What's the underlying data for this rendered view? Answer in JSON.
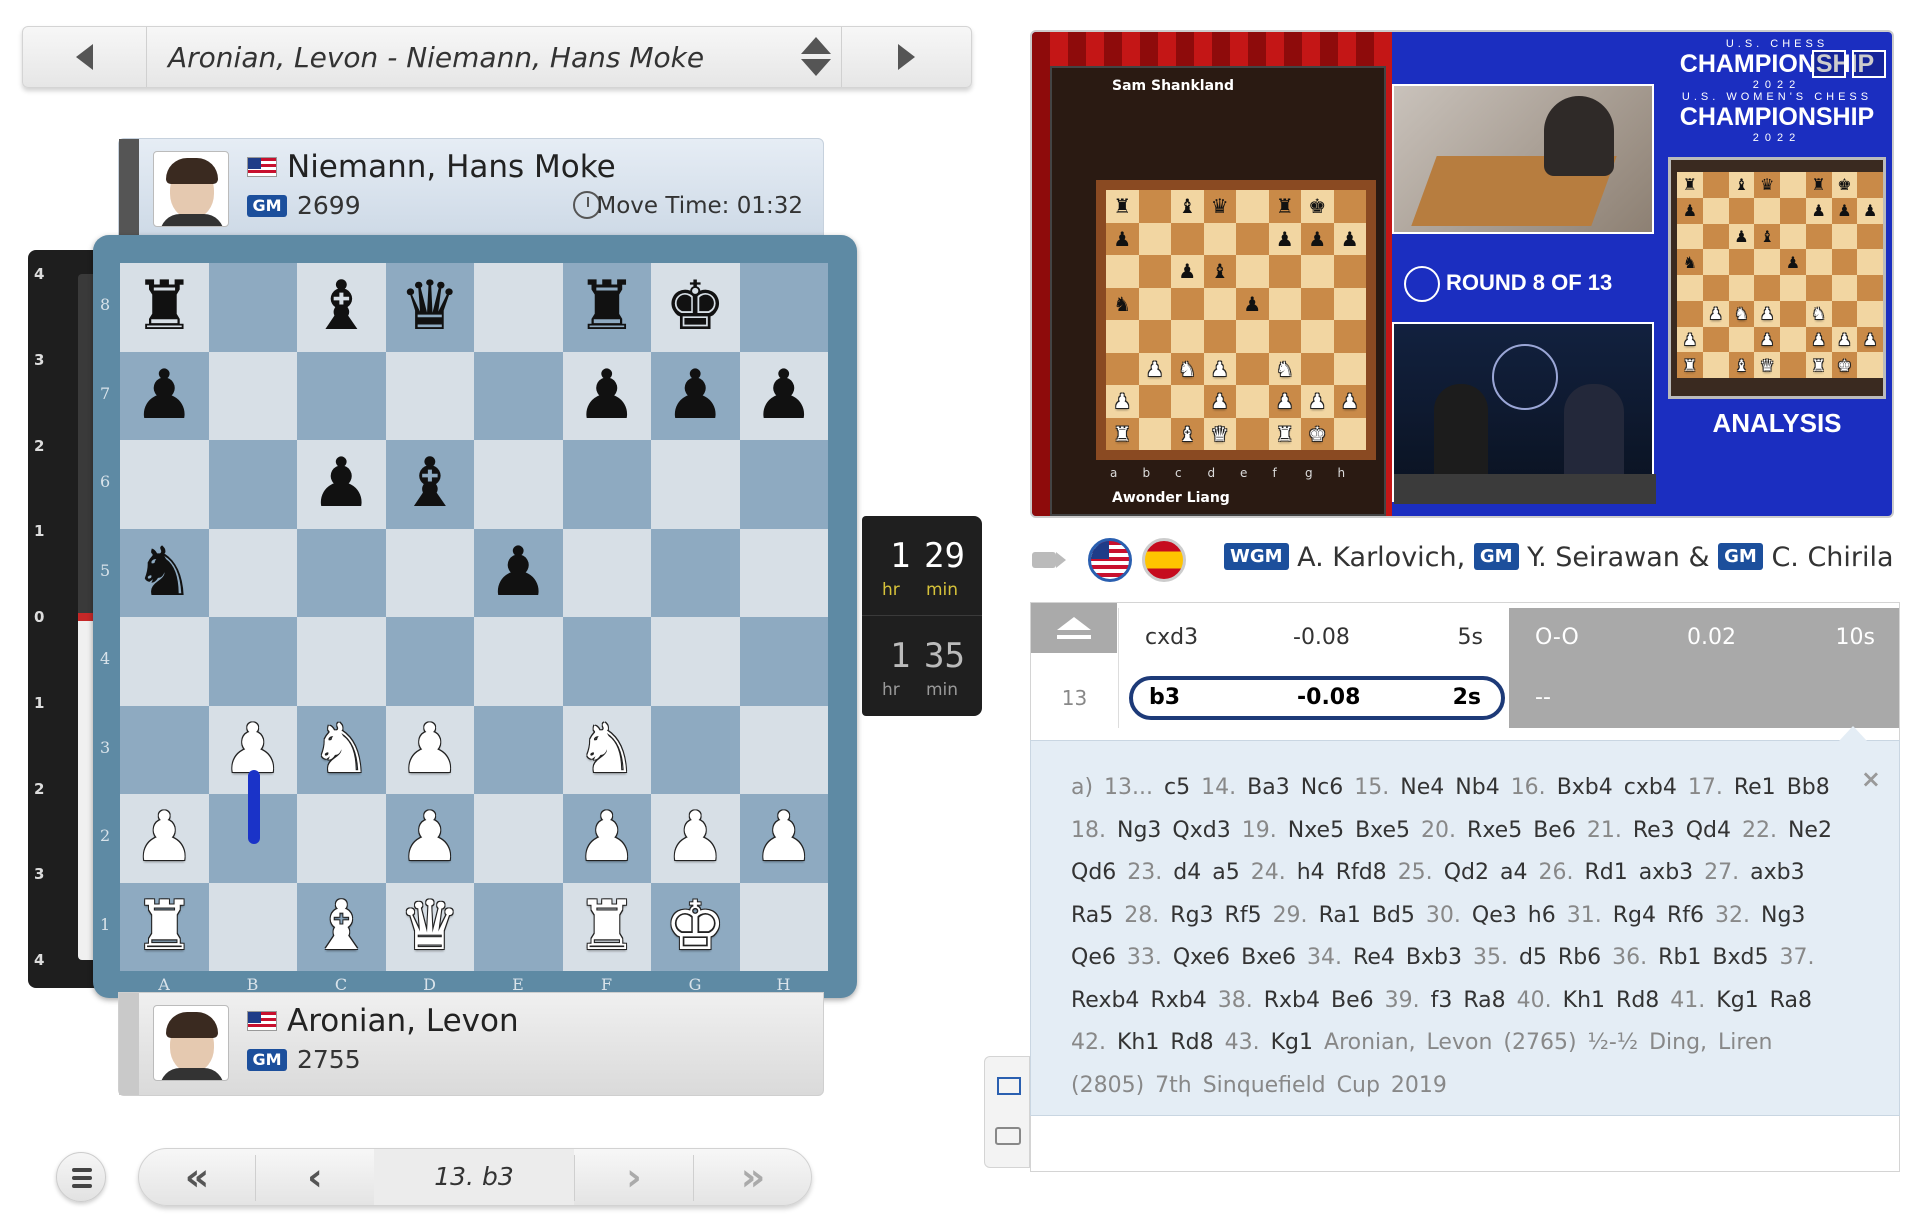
{
  "game_selector": {
    "title": "Aronian, Levon - Niemann, Hans Moke"
  },
  "top_player": {
    "name": "Niemann, Hans Moke",
    "title": "GM",
    "rating": "2699",
    "move_time": "Move Time: 01:32"
  },
  "bottom_player": {
    "name": "Aronian, Levon",
    "title": "GM",
    "rating": "2755"
  },
  "eval_bar": {
    "ticks": [
      "4",
      "3",
      "2",
      "1",
      "0",
      "1",
      "2",
      "3",
      "4"
    ],
    "white_fraction": 0.5
  },
  "board": {
    "rank_labels": [
      "8",
      "7",
      "6",
      "5",
      "4",
      "3",
      "2",
      "1"
    ],
    "file_labels": [
      "A",
      "B",
      "C",
      "D",
      "E",
      "F",
      "G",
      "H"
    ],
    "position": [
      [
        "r",
        "",
        "b",
        "q",
        "",
        "r",
        "k",
        ""
      ],
      [
        "p",
        "",
        "",
        "",
        "",
        "p",
        "p",
        "p"
      ],
      [
        "",
        "",
        "p",
        "b",
        "",
        "",
        "",
        ""
      ],
      [
        "n",
        "",
        "",
        "",
        "p",
        "",
        "",
        ""
      ],
      [
        "",
        "",
        "",
        "",
        "",
        "",
        "",
        ""
      ],
      [
        "",
        "P",
        "N",
        "P",
        "",
        "N",
        "",
        ""
      ],
      [
        "P",
        "",
        "",
        "P",
        "",
        "P",
        "P",
        "P"
      ],
      [
        "R",
        "",
        "B",
        "Q",
        "",
        "R",
        "K",
        ""
      ]
    ],
    "last_move_color": "#1a33c8"
  },
  "clocks": {
    "top": {
      "hours": "1",
      "minutes": "29",
      "hr_label": "hr",
      "min_label": "min"
    },
    "bottom": {
      "hours": "1",
      "minutes": "35",
      "hr_label": "hr",
      "min_label": "min"
    }
  },
  "navigation": {
    "current_move": "13. b3"
  },
  "broadcast": {
    "top_player": "Sam Shankland",
    "bottom_player": "Awonder Liang",
    "round": "ROUND 8 OF 13",
    "championship_small": "U.S. CHESS",
    "championship_large": "CHAMPIONSHIP",
    "championship_year": "2022",
    "womens_small": "U.S. WOMEN'S CHESS",
    "womens_large": "CHAMPIONSHIP",
    "womens_year": "2022",
    "analysis_label": "ANALYSIS",
    "board_files": [
      "a",
      "b",
      "c",
      "d",
      "e",
      "f",
      "g",
      "h"
    ]
  },
  "commentary": {
    "commentators": [
      {
        "title": "WGM",
        "name": "A. Karlovich,"
      },
      {
        "title": "GM",
        "name": "Y. Seirawan &"
      },
      {
        "title": "GM",
        "name": "C. Chirila"
      }
    ]
  },
  "moves": [
    {
      "number": "12",
      "white": "cxd3",
      "white_eval": "-0.08",
      "white_time": "5s",
      "black": "O-O",
      "black_eval": "0.02",
      "black_time": "10s"
    },
    {
      "number": "13",
      "white": "b3",
      "white_eval": "-0.08",
      "white_time": "2s",
      "black": "--",
      "black_eval": "",
      "black_time": ""
    }
  ],
  "variation": {
    "prefix": "a) 13...",
    "moves": [
      "c5",
      "14.",
      "Ba3",
      "Nc6",
      "15.",
      "Ne4",
      "Nb4",
      "16.",
      "Bxb4",
      "cxb4",
      "17.",
      "Re1",
      "Bb8",
      "18.",
      "Ng3",
      "Qxd3",
      "19.",
      "Nxe5",
      "Bxe5",
      "20.",
      "Rxe5",
      "Be6",
      "21.",
      "Re3",
      "Qd4",
      "22.",
      "Ne2",
      "Qd6",
      "23.",
      "d4",
      "a5",
      "24.",
      "h4",
      "Rfd8",
      "25.",
      "Qd2",
      "a4",
      "26.",
      "Rd1",
      "axb3",
      "27.",
      "axb3",
      "Ra5",
      "28.",
      "Rg3",
      "Rf5",
      "29.",
      "Ra1",
      "Bd5",
      "30.",
      "Qe3",
      "h6",
      "31.",
      "Rg4",
      "Rf6",
      "32.",
      "Ng3",
      "Qe6",
      "33.",
      "Qxe6",
      "Bxe6",
      "34.",
      "Re4",
      "Bxb3",
      "35.",
      "d5",
      "Rb6",
      "36.",
      "Rb1",
      "Bxd5",
      "37.",
      "Rexb4",
      "Rxb4",
      "38.",
      "Rxb4",
      "Be6",
      "39.",
      "f3",
      "Ra8",
      "40.",
      "Kh1",
      "Rd8",
      "41.",
      "Kg1",
      "Ra8",
      "42.",
      "Kh1",
      "Rd8",
      "43.",
      "Kg1"
    ],
    "source": "Aronian, Levon (2765) ½-½ Ding, Liren (2805) 7th Sinquefield Cup 2019",
    "close": "×"
  }
}
